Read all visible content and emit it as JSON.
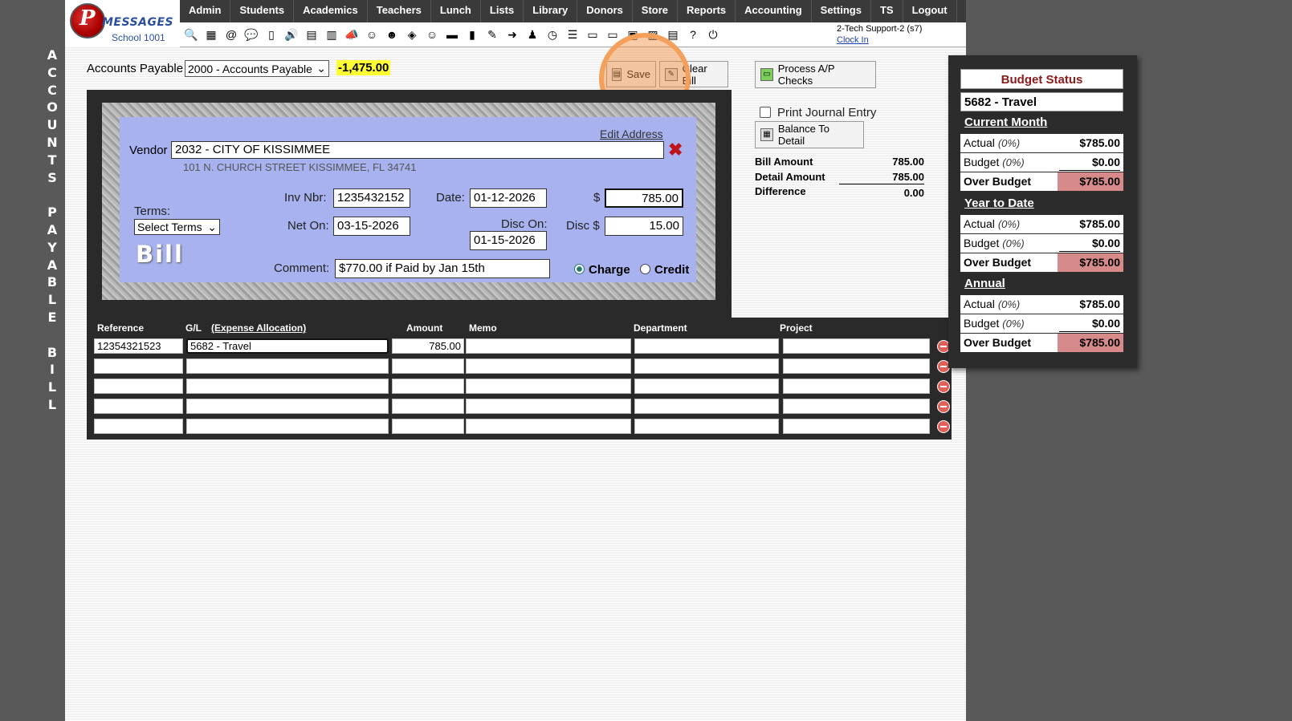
{
  "sidebar_title_letters": [
    "A",
    "C",
    "C",
    "O",
    "U",
    "N",
    "T",
    "S",
    " ",
    "P",
    "A",
    "Y",
    "A",
    "B",
    "L",
    "E",
    " ",
    "B",
    "I",
    "L",
    "L"
  ],
  "logo": {
    "word": "MESSAGES",
    "school": "School 1001"
  },
  "topnav": [
    "Admin",
    "Students",
    "Academics",
    "Teachers",
    "Lunch",
    "Lists",
    "Library",
    "Donors",
    "Store",
    "Reports",
    "Accounting",
    "Settings",
    "TS",
    "Logout"
  ],
  "toolbar_icons": [
    "search-icon",
    "calendar-grid-icon",
    "email-icon",
    "chat-icon",
    "phone-icon",
    "speaker-icon",
    "form-icon",
    "calendar-icon",
    "megaphone-icon",
    "student-icon",
    "teacher-icon",
    "money-icon",
    "parents-icon",
    "lunch-icon",
    "book-icon",
    "broom-icon",
    "arrow-icon",
    "person-icon",
    "clock-icon",
    "list-icon",
    "cash-icon",
    "card-icon",
    "ap-icon",
    "pdf-icon",
    "money-stack-icon",
    "help-icon",
    "power-icon"
  ],
  "user": {
    "name": "2-Tech Support-2 (s7)",
    "clock_in": "Clock In"
  },
  "accounts_payable": {
    "label": "Accounts Payable",
    "selected": "2000 - Accounts Payable",
    "balance": "-1,475.00"
  },
  "buttons": {
    "save": "Save",
    "clear_bill": "Clear Bill",
    "process_checks": "Process A/P Checks",
    "print_journal": "Print Journal Entry",
    "balance_to_detail": "Balance To Detail"
  },
  "bill": {
    "edit_address": "Edit Address",
    "vendor_label": "Vendor",
    "vendor": "2032 - CITY OF KISSIMMEE",
    "address": "101 N. CHURCH STREET KISSIMMEE, FL 34741",
    "terms_label": "Terms:",
    "terms_selected": "Select Terms",
    "inv_label": "Inv Nbr:",
    "inv_nbr": "1235432152",
    "date_label": "Date:",
    "date": "01-12-2026",
    "dollar_label": "$",
    "amount": "785.00",
    "net_label": "Net On:",
    "net_on": "03-15-2026",
    "disc_on_label": "Disc On:",
    "disc_on": "01-15-2026",
    "disc_label": "Disc $",
    "disc_amount": "15.00",
    "bill_word": "Bill",
    "comment_label": "Comment:",
    "comment": "$770.00 if Paid by Jan 15th",
    "charge_label": "Charge",
    "credit_label": "Credit"
  },
  "totals": [
    {
      "label": "Bill Amount",
      "value": "785.00"
    },
    {
      "label": "Detail Amount",
      "value": "785.00"
    },
    {
      "label": "Difference",
      "value": "0.00"
    }
  ],
  "detail": {
    "headers": {
      "reference": "Reference",
      "gl": "G/L",
      "expense_allocation": "(Expense Allocation)",
      "amount": "Amount",
      "memo": "Memo",
      "department": "Department",
      "project": "Project"
    },
    "rows": [
      {
        "reference": "12354321523",
        "gl": "5682 - Travel",
        "amount": "785.00",
        "memo": "",
        "department": "",
        "project": ""
      },
      {
        "reference": "",
        "gl": "",
        "amount": "",
        "memo": "",
        "department": "",
        "project": ""
      },
      {
        "reference": "",
        "gl": "",
        "amount": "",
        "memo": "",
        "department": "",
        "project": ""
      },
      {
        "reference": "",
        "gl": "",
        "amount": "",
        "memo": "",
        "department": "",
        "project": ""
      },
      {
        "reference": "",
        "gl": "",
        "amount": "",
        "memo": "",
        "department": "",
        "project": ""
      }
    ]
  },
  "budget": {
    "title": "Budget Status",
    "account": "5682 - Travel",
    "sections": [
      {
        "name": "Current Month",
        "actual_label": "Actual",
        "actual_pct": "(0%)",
        "actual": "$785.00",
        "budget_label": "Budget",
        "budget_pct": "(0%)",
        "budget": "$0.00",
        "over_label": "Over Budget",
        "over": "$785.00"
      },
      {
        "name": "Year to Date",
        "actual_label": "Actual",
        "actual_pct": "(0%)",
        "actual": "$785.00",
        "budget_label": "Budget",
        "budget_pct": "(0%)",
        "budget": "$0.00",
        "over_label": "Over Budget",
        "over": "$785.00"
      },
      {
        "name": "Annual",
        "actual_label": "Actual",
        "actual_pct": "(0%)",
        "actual": "$785.00",
        "budget_label": "Budget",
        "budget_pct": "(0%)",
        "budget": "$0.00",
        "over_label": "Over Budget",
        "over": "$785.00"
      }
    ]
  }
}
